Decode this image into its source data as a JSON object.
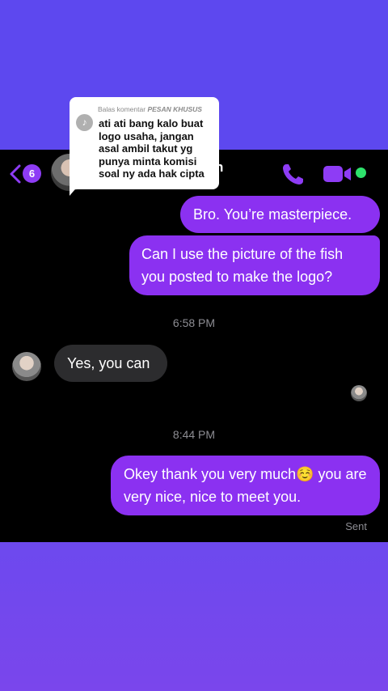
{
  "comment_card": {
    "header_prefix": "Balas komentar",
    "header_user": "PESAN KHUSUS",
    "icon": "tiktok-icon",
    "text": "ati ati bang kalo buat logo usaha, jangan asal ambil takut yg punya minta komisi soal ny ada hak cipta"
  },
  "header": {
    "unread_count": "6",
    "name_fragment": "n",
    "icons": [
      "back-chevron-icon",
      "phone-icon",
      "video-camera-icon"
    ],
    "accent_color": "#8e3cf5",
    "online_color": "#2ee26c"
  },
  "messages": {
    "m1": "Bro. You’re masterpiece.",
    "m2": "Can I use the picture of the fish you posted to make the logo?",
    "t1": "6:58 PM",
    "m3": "Yes, you can",
    "t2": "8:44 PM",
    "m4": "Okey thank you very much☺️ you are very nice, nice to meet you.",
    "status": "Sent"
  },
  "colors": {
    "outgoing_bubble": "#8b31f1",
    "incoming_bubble": "#2c2c2e",
    "background_top": "#5d48ef"
  }
}
